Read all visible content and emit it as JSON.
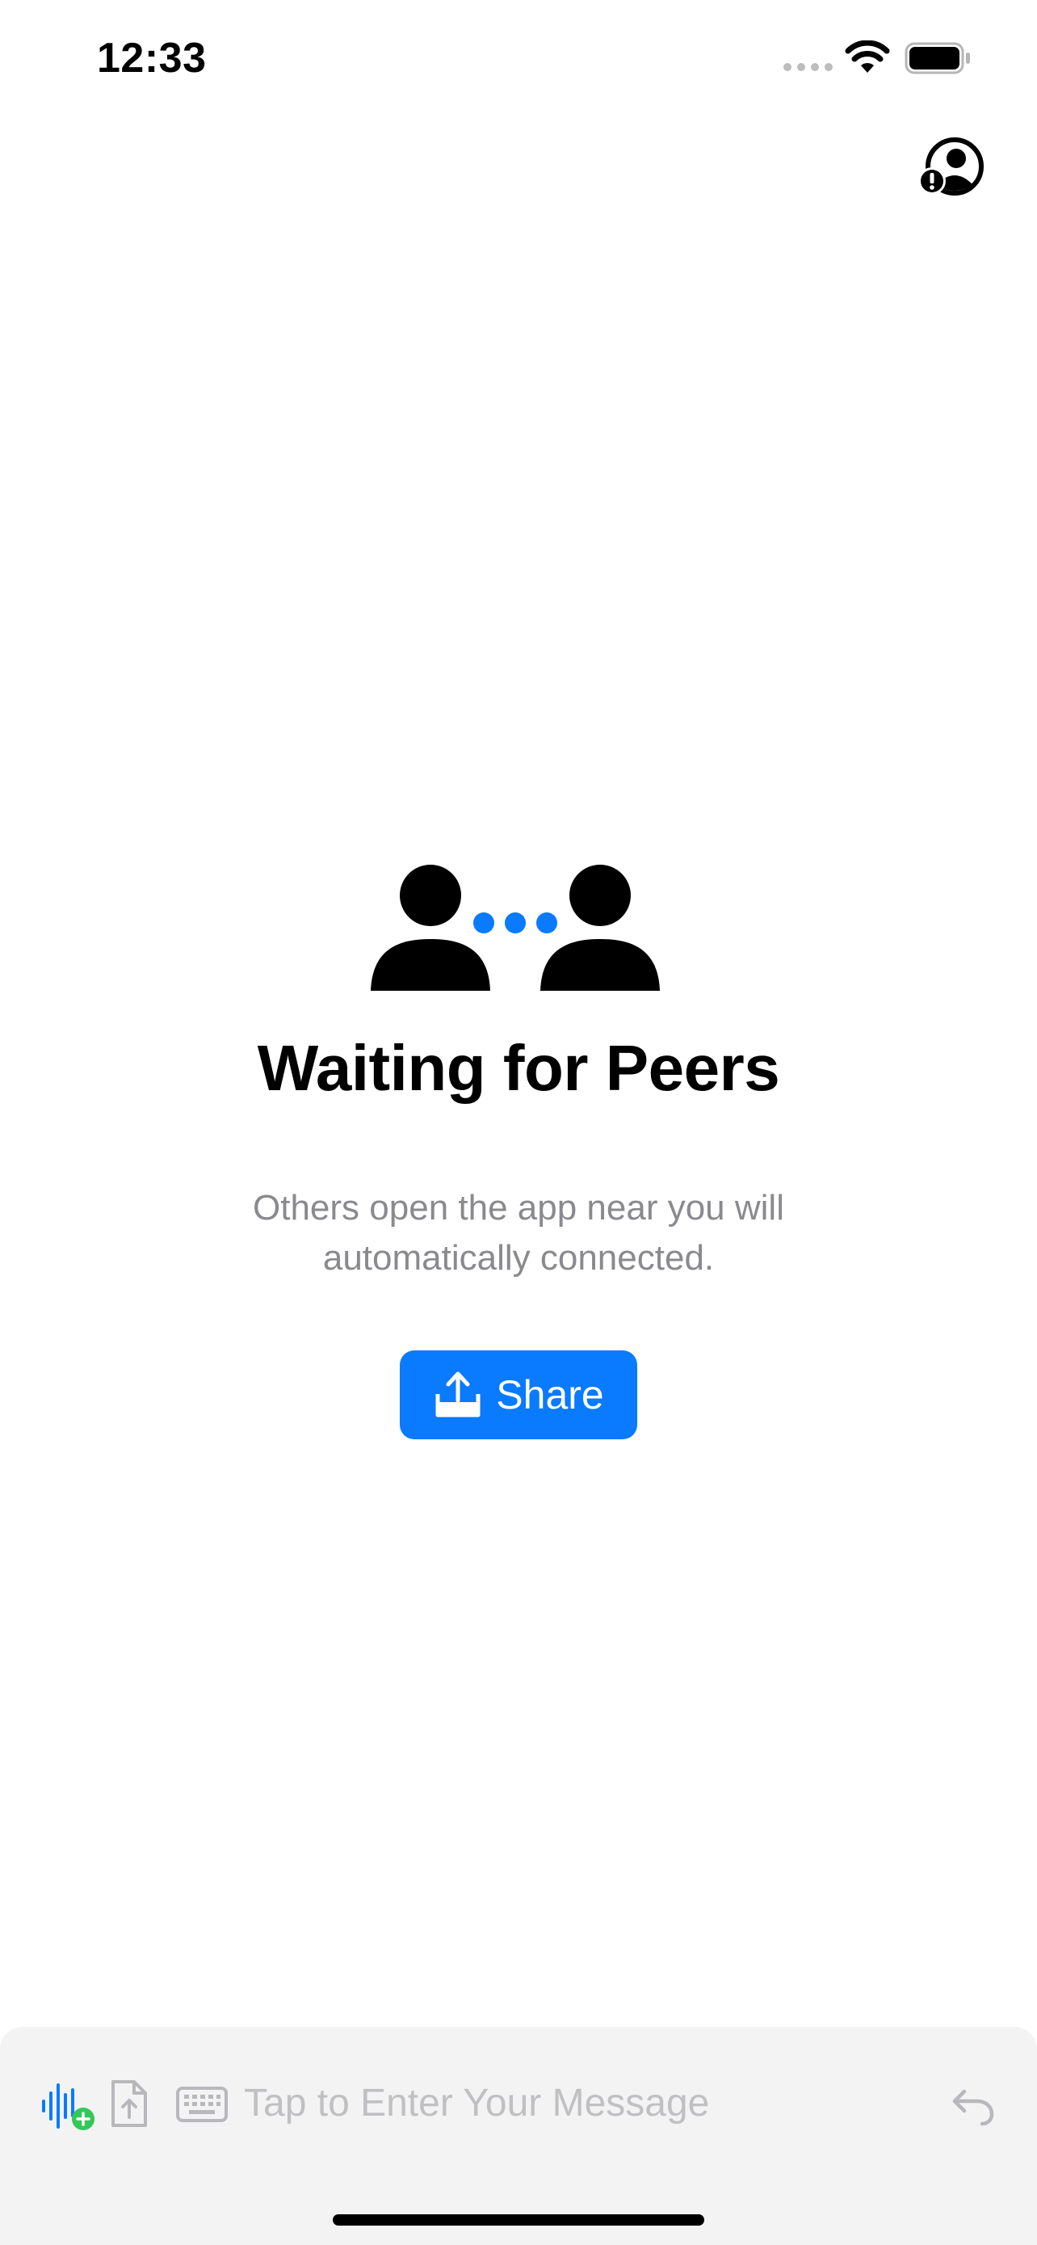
{
  "status_bar": {
    "time": "12:33"
  },
  "main": {
    "title": "Waiting for Peers",
    "subtitle": "Others open the app near you will automatically connected.",
    "share_label": "Share"
  },
  "composer": {
    "placeholder": "Tap to Enter Your Message"
  },
  "colors": {
    "accent": "#0A7AFF",
    "add_badge": "#34C759",
    "placeholder_text": "#C0C0C3",
    "subtitle_text": "#8A8A8E",
    "composer_background": "#F3F3F4"
  },
  "icons": {
    "top_right": "person-exclamation-icon",
    "illustration": "two-people-waiting-icon",
    "share": "tray-and-arrow-up-icon",
    "voice": "waveform-add-icon",
    "file": "doc-upload-icon",
    "keyboard": "keyboard-icon",
    "undo": "undo-arrow-icon"
  }
}
